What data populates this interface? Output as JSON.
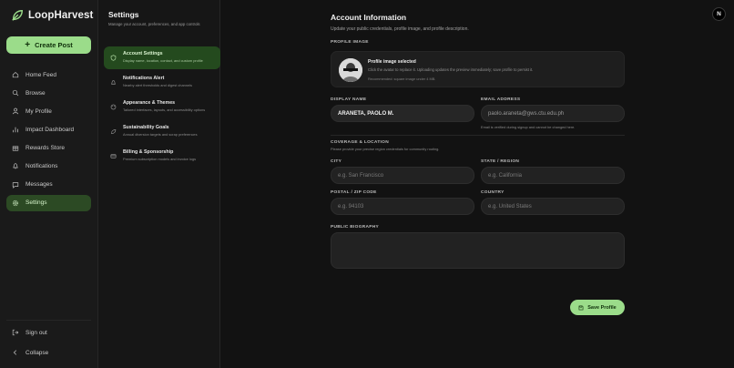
{
  "brand": {
    "name": "LoopHarvest",
    "accent": "#9bdc8a"
  },
  "sidebar": {
    "create_label": "Create Post",
    "items": [
      {
        "label": "Home Feed",
        "icon": "home-icon"
      },
      {
        "label": "Browse",
        "icon": "search-icon"
      },
      {
        "label": "My Profile",
        "icon": "user-icon"
      },
      {
        "label": "Impact Dashboard",
        "icon": "chart-icon"
      },
      {
        "label": "Rewards Store",
        "icon": "gift-icon"
      },
      {
        "label": "Notifications",
        "icon": "bell-icon"
      },
      {
        "label": "Messages",
        "icon": "message-icon"
      },
      {
        "label": "Settings",
        "icon": "gear-icon",
        "active": true
      }
    ],
    "bottom": [
      {
        "label": "Sign out",
        "icon": "sign-out-icon"
      },
      {
        "label": "Collapse",
        "icon": "chevron-left-icon"
      }
    ]
  },
  "settings": {
    "title": "Settings",
    "description": "Manage your account, preferences, and app controls",
    "menu": [
      {
        "label": "Account Settings",
        "sub": "Display name, location, contact, and custom profile",
        "icon": "shield-icon",
        "active": true
      },
      {
        "label": "Notifications Alert",
        "sub": "Nearby alert thresholds and digest channels",
        "icon": "bell-icon"
      },
      {
        "label": "Appearance & Themes",
        "sub": "Tailored interfaces, layouts, and accessibility options",
        "icon": "palette-icon"
      },
      {
        "label": "Sustainability Goals",
        "sub": "Annual diversion targets and scrap preferences",
        "icon": "leaf-icon"
      },
      {
        "label": "Billing & Sponsorship",
        "sub": "Premium subscription models and invoice logs",
        "icon": "card-icon"
      }
    ]
  },
  "corner_avatar": "N",
  "account": {
    "title": "Account Information",
    "subtitle": "Update your public credentials, profile image, and profile description.",
    "profile_image": {
      "section": "PROFILE IMAGE",
      "title": "Profile image selected",
      "desc": "Click the avatar to replace it. Uploading updates the preview immediately; save profile to persist it.",
      "note": "Recommended: square image under 4 MB."
    },
    "display_name": {
      "label": "DISPLAY NAME",
      "value": "ARANETA, PAOLO M."
    },
    "email": {
      "label": "EMAIL ADDRESS",
      "value": "paolo.araneta@gws.ctu.edu.ph",
      "hint": "Email is verified during signup and cannot be changed here."
    },
    "coverage": {
      "title": "COVERAGE & LOCATION",
      "desc": "Please provide your precise region credentials for community routing."
    },
    "city": {
      "label": "CITY",
      "placeholder": "e.g. San Francisco"
    },
    "state": {
      "label": "STATE / REGION",
      "placeholder": "e.g. California"
    },
    "postal": {
      "label": "POSTAL / ZIP CODE",
      "placeholder": "e.g. 94103"
    },
    "country": {
      "label": "COUNTRY",
      "placeholder": "e.g. United States"
    },
    "bio": {
      "label": "PUBLIC BIOGRAPHY",
      "value": ""
    },
    "save_label": "Save Profile"
  }
}
